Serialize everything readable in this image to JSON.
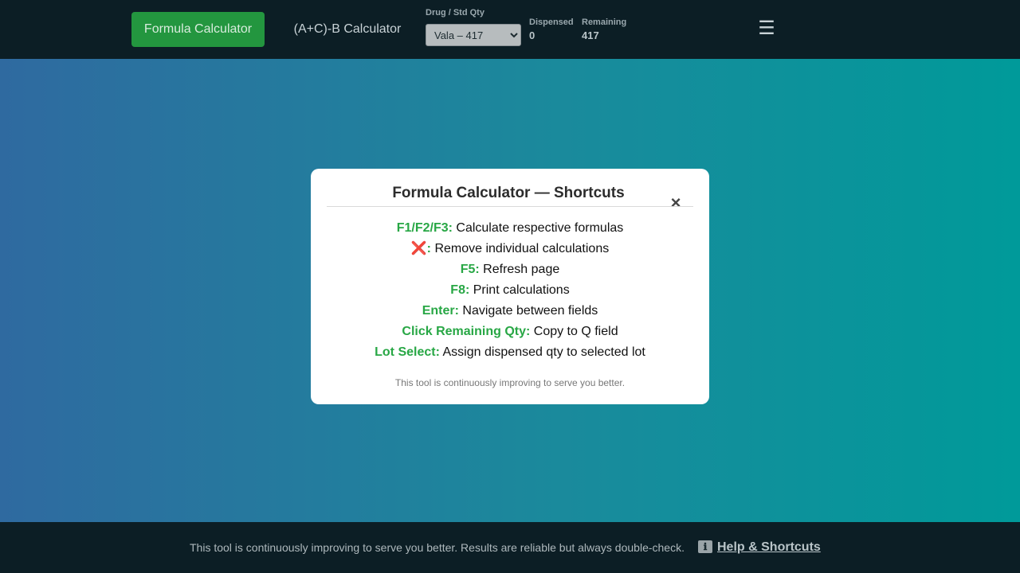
{
  "nav": {
    "formula_button": "Formula Calculator",
    "acb_button": "(A+C)-B Calculator",
    "drug_label": "Drug / Std Qty",
    "drug_selected": "Vala – 417",
    "dispensed_label": "Dispensed",
    "dispensed_value": "0",
    "remaining_label": "Remaining",
    "remaining_value": "417",
    "menu_icon": "☰"
  },
  "modal": {
    "title": "Formula Calculator — Shortcuts",
    "close_icon": "×",
    "shortcuts": [
      {
        "key": "F1/F2/F3:",
        "desc": " Calculate respective formulas"
      },
      {
        "key": "❌:",
        "desc": " Remove individual calculations"
      },
      {
        "key": "F5:",
        "desc": " Refresh page"
      },
      {
        "key": "F8:",
        "desc": " Print calculations"
      },
      {
        "key": "Enter:",
        "desc": " Navigate between fields"
      },
      {
        "key": "Click Remaining Qty:",
        "desc": " Copy to Q field"
      },
      {
        "key": "Lot Select:",
        "desc": " Assign dispensed qty to selected lot"
      }
    ],
    "note": "This tool is continuously improving to serve you better."
  },
  "footer": {
    "text": "This tool is continuously improving to serve you better. Results are reliable but always double-check.",
    "help_icon": "ℹ",
    "help_label": "Help & Shortcuts"
  },
  "colors": {
    "accent_green": "#28a745",
    "button_green": "#23963f",
    "bar_dark": "#0c1e25"
  }
}
